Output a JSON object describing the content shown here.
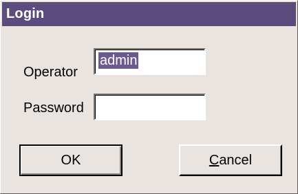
{
  "window": {
    "title": "Login"
  },
  "form": {
    "operator_label": "Operator",
    "operator_value": "admin",
    "password_label": "Password",
    "password_value": ""
  },
  "buttons": {
    "ok_label": "OK",
    "cancel_label": "Cancel"
  },
  "colors": {
    "titlebar": "#5c4c7d",
    "dialog_background": "#e9e4df",
    "selection": "#6b5a8d"
  }
}
